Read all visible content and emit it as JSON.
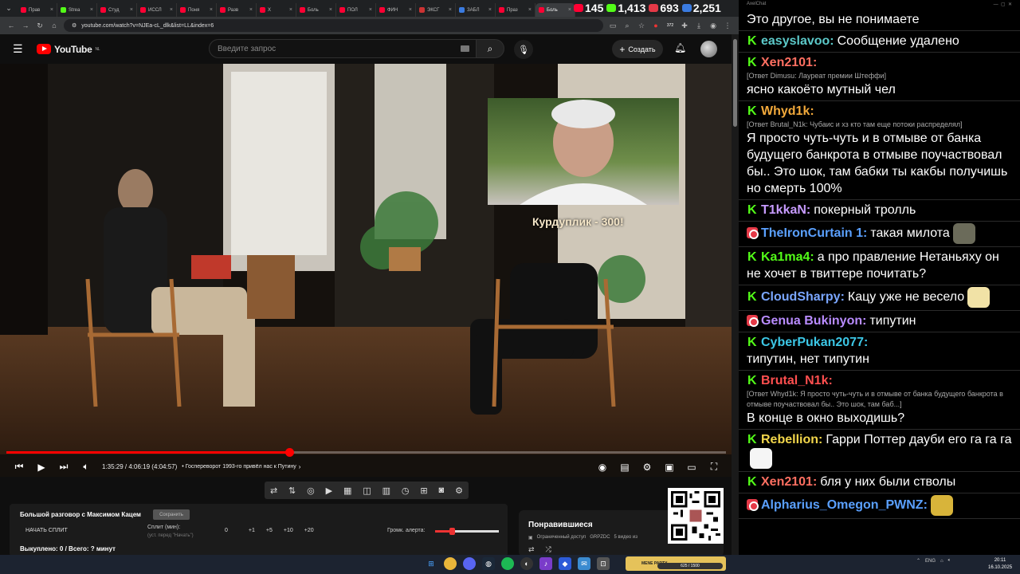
{
  "browser": {
    "tabs": [
      {
        "label": "Прав",
        "color": "#ff0033"
      },
      {
        "label": "Strea",
        "color": "#53fc18"
      },
      {
        "label": "Студ",
        "color": "#ff0033"
      },
      {
        "label": "ИССЛ",
        "color": "#ff0033"
      },
      {
        "label": "Поня",
        "color": "#ff0033"
      },
      {
        "label": "Разв",
        "color": "#ff0033"
      },
      {
        "label": "Х",
        "color": "#ff0033"
      },
      {
        "label": "Боль",
        "color": "#ff0033"
      },
      {
        "label": "ПОЛ",
        "color": "#ff0033"
      },
      {
        "label": "ФИН",
        "color": "#ff0033"
      },
      {
        "label": "ЭКСГ",
        "color": "#c33"
      },
      {
        "label": "ЗАБЛ",
        "color": "#3a7be0"
      },
      {
        "label": "Праз",
        "color": "#ff0033"
      },
      {
        "label": "Боль",
        "color": "#ff0033"
      }
    ],
    "url": "youtube.com/watch?v=NJEa-cL_dlk&list=LL&index=6",
    "ext_badge": "372"
  },
  "counters": [
    {
      "value": "145",
      "color": "#ff0033"
    },
    {
      "value": "1,413",
      "color": "#53fc18"
    },
    {
      "value": "693",
      "color": "#e53947"
    },
    {
      "value": "2,251",
      "color": "#3a7be0"
    }
  ],
  "youtube": {
    "logo_text": "YouTube",
    "region": "NL",
    "search_placeholder": "Введите запрос",
    "create_label": "Создать"
  },
  "video": {
    "progress": 0.393,
    "time": "1:35:29 / 4:06:19 (4:04:57)",
    "chapter": "• Госпереворот 1993-го привёл нас к Путину",
    "caption": "Курдуплик - 300!"
  },
  "panel": {
    "title": "Большой разговор с Максимом Кацем",
    "badge": "Сохранить",
    "start_label": "НАЧАТЬ СПЛИТ",
    "split_label": "Сплит (мин):",
    "split_sub": "(уст. перед \"Начать\")",
    "split_value": "0",
    "increments": [
      "+1",
      "+5",
      "+10",
      "+20"
    ],
    "alert_label": "Громк. алерта:",
    "alert_volume": 0.22,
    "total": "Выкуплено: 0 / Всего: ? минут"
  },
  "playlist": {
    "title": "Понравившиеся",
    "access": "Ограниченный доступ",
    "owner": "GRPZDC",
    "count": "5 видео из"
  },
  "chat": {
    "header": "AxelChat",
    "messages": [
      {
        "platform": "k",
        "name": "",
        "name_color": "#fff",
        "reply": "",
        "text": "Это другое, вы не понимаете"
      },
      {
        "platform": "k",
        "name": "easyslavoo:",
        "name_color": "#5cc9c9",
        "reply": "",
        "text": "Сообщение удалено"
      },
      {
        "platform": "k",
        "name": "Xen2101:",
        "name_color": "#ff6f61",
        "reply": "[Ответ Dimusu: Лауреат премии Штеффи]",
        "text": "ясно какоёто мутный чел"
      },
      {
        "platform": "k",
        "name": "Whyd1k:",
        "name_color": "#f2a93b",
        "reply": "[Ответ Brutal_N1k: Чубаис и хз кто там еще потоки распределял]",
        "text": "Я просто чуть-чуть и в отмыве от банка будущего банкрота в отмыве поучаствовал бы.. Это шок, там бабки ты какбы получишь но смерть 100%"
      },
      {
        "platform": "k",
        "name": "T1kkaN:",
        "name_color": "#c79bff",
        "reply": "",
        "text": "покерный тролль"
      },
      {
        "platform": "l",
        "name": "TheIronCurtain 1:",
        "name_color": "#5aa0ff",
        "reply": "",
        "text": "такая милота",
        "emote": "#6b6b5a"
      },
      {
        "platform": "k",
        "name": "Ka1ma4:",
        "name_color": "#53fc18",
        "reply": "",
        "text": "а про правление Нетаньяху он не хочет в твиттере почитать?"
      },
      {
        "platform": "k",
        "name": "CloudSharpy:",
        "name_color": "#7aa6ff",
        "reply": "",
        "text": "Кацу уже не весело",
        "emote": "#f1e2a6"
      },
      {
        "platform": "l",
        "name": "Genua Bukinyon:",
        "name_color": "#b98cff",
        "reply": "",
        "text": "типутин"
      },
      {
        "platform": "k",
        "name": "CyberPukan2077:",
        "name_color": "#3cc7e6",
        "reply": "",
        "text": "типутин, нет типутин"
      },
      {
        "platform": "k",
        "name": "Brutal_N1k:",
        "name_color": "#ff4f4f",
        "reply": "[Ответ Whyd1k: Я просто чуть-чуть и в отмыве от банка будущего банкрота в отмыве поучаствовал бы.. Это шок, там баб...]",
        "text": "В конце в окно выходишь?"
      },
      {
        "platform": "k",
        "name": "Rebellion:",
        "name_color": "#f2d64b",
        "reply": "",
        "text": "Гарри Поттер дауби его га га га",
        "emote": "#f5f5f5"
      },
      {
        "platform": "k",
        "name": "Xen2101:",
        "name_color": "#ff6f61",
        "reply": "",
        "text": "бля у них были стволы"
      },
      {
        "platform": "l",
        "name": "Alpharius_Omegon_PWNZ:",
        "name_color": "#5aa0ff",
        "reply": "",
        "text": "",
        "emote": "#d8b43a"
      }
    ]
  },
  "taskbar": {
    "mene_label": "MENE PARTY",
    "mene_progress": "625 / 1500",
    "lang": "ENG",
    "time": "20:11",
    "date": "16.10.2025"
  }
}
